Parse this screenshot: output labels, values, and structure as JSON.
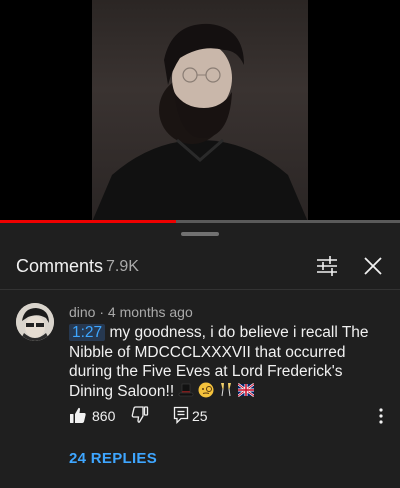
{
  "video": {
    "progress": 0.44
  },
  "header": {
    "title": "Comments",
    "count": "7.9K"
  },
  "comment": {
    "author": "dino",
    "separator": "·",
    "time_ago": "4 months ago",
    "timestamp": "1:27",
    "text": "my goodness, i do believe i recall The Nibble of MDCCCLXXXVII that occurred during the Five Eves at Lord Frederick's Dining Saloon!!",
    "emojis": [
      "tophat-icon",
      "monocle-face-icon",
      "champagne-glasses-icon",
      "uk-flag-icon"
    ],
    "likes": "860",
    "replies_count": "25",
    "replies_label": "24 REPLIES"
  },
  "colors": {
    "accent": "#3ea6ff",
    "progress": "#ff0000",
    "background": "#1f1f1f"
  }
}
